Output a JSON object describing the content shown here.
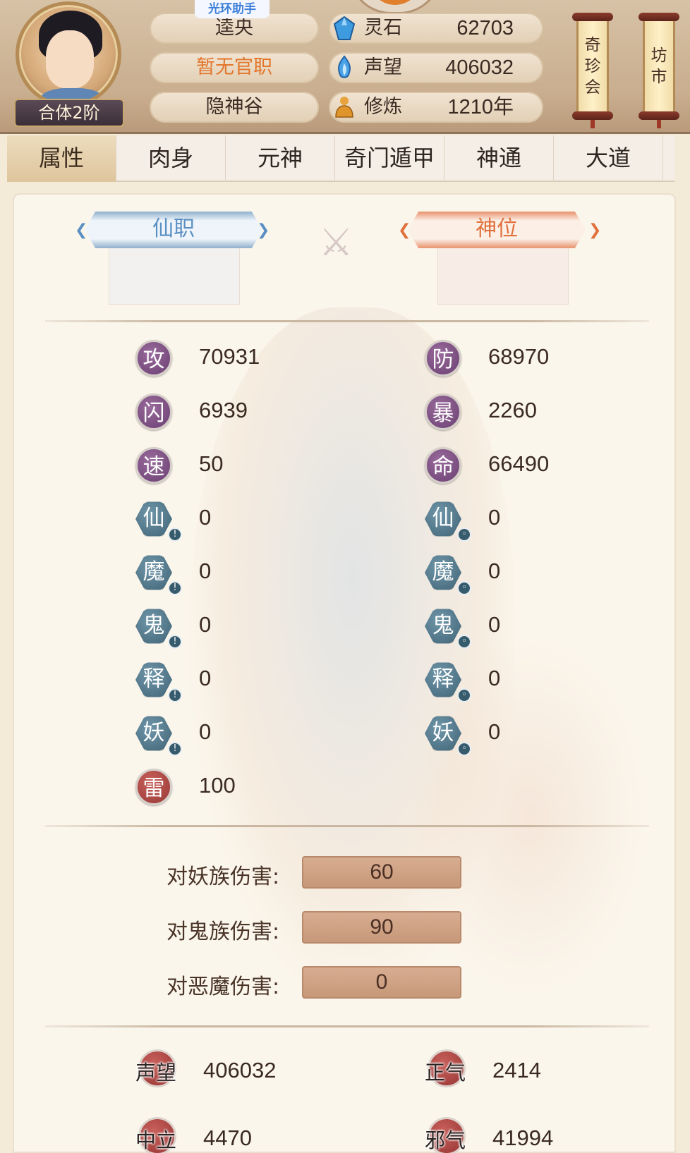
{
  "header": {
    "rank_badge": "合体2阶",
    "bookmark_tag": "光环助手",
    "name": "逵央",
    "official_post": "暂无官职",
    "sect": "隐神谷",
    "resources": [
      {
        "label": "灵石",
        "value": "62703",
        "icon": "blue-crystal-icon"
      },
      {
        "label": "声望",
        "value": "406032",
        "icon": "blue-flame-icon"
      },
      {
        "label": "修炼",
        "value": "1210年",
        "icon": "meditating-figure-icon"
      }
    ],
    "scroll_buttons": [
      {
        "label": [
          "奇",
          "珍",
          "会"
        ]
      },
      {
        "label": [
          "坊",
          "市"
        ]
      }
    ]
  },
  "tabs": [
    {
      "label": "属性",
      "active": true
    },
    {
      "label": "肉身",
      "active": false
    },
    {
      "label": "元神",
      "active": false
    },
    {
      "label": "奇门遁甲",
      "active": false
    },
    {
      "label": "神通",
      "active": false
    },
    {
      "label": "大道",
      "active": false
    }
  ],
  "panel": {
    "immortal_post": "仙职",
    "divine_rank": "神位",
    "left_stats": [
      {
        "glyph": "攻",
        "value": "70931",
        "style": "purple"
      },
      {
        "glyph": "闪",
        "value": "6939",
        "style": "purple"
      },
      {
        "glyph": "速",
        "value": "50",
        "style": "purple"
      },
      {
        "glyph": "仙",
        "value": "0",
        "style": "slate"
      },
      {
        "glyph": "魔",
        "value": "0",
        "style": "slate"
      },
      {
        "glyph": "鬼",
        "value": "0",
        "style": "slate"
      },
      {
        "glyph": "释",
        "value": "0",
        "style": "slate"
      },
      {
        "glyph": "妖",
        "value": "0",
        "style": "slate"
      },
      {
        "glyph": "雷",
        "value": "100",
        "style": "red"
      }
    ],
    "right_stats": [
      {
        "glyph": "防",
        "value": "68970",
        "style": "purple"
      },
      {
        "glyph": "暴",
        "value": "2260",
        "style": "purple"
      },
      {
        "glyph": "命",
        "value": "66490",
        "style": "purple"
      },
      {
        "glyph": "仙",
        "value": "0",
        "style": "slate"
      },
      {
        "glyph": "魔",
        "value": "0",
        "style": "slate"
      },
      {
        "glyph": "鬼",
        "value": "0",
        "style": "slate"
      },
      {
        "glyph": "释",
        "value": "0",
        "style": "slate"
      },
      {
        "glyph": "妖",
        "value": "0",
        "style": "slate"
      }
    ],
    "damage_bonuses": [
      {
        "label": "对妖族伤害:",
        "value": "60"
      },
      {
        "label": "对鬼族伤害:",
        "value": "90"
      },
      {
        "label": "对恶魔伤害:",
        "value": "0"
      }
    ],
    "reputation": [
      {
        "label": "声望",
        "value": "406032"
      },
      {
        "label": "正气",
        "value": "2414"
      },
      {
        "label": "中立",
        "value": "4470"
      },
      {
        "label": "邪气",
        "value": "41994"
      }
    ]
  }
}
